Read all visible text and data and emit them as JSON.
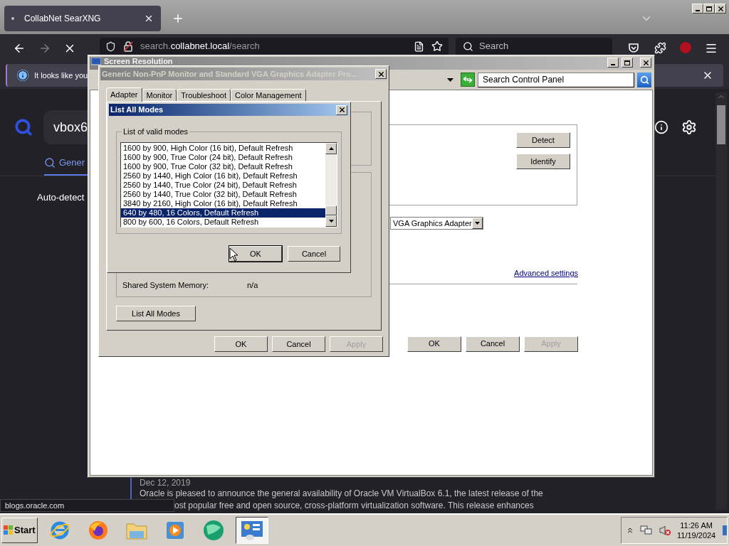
{
  "browser": {
    "tab_title": "CollabNet SearXNG",
    "url_prefix": "search.",
    "url_domain": "collabnet.local",
    "url_path": "/search",
    "search_placeholder": "Search",
    "notification": "It looks like you",
    "query": "vbox6",
    "category_tab": {
      "label": "Gener",
      "selected": true
    },
    "auto_detect": "Auto-detect",
    "result": {
      "date": "Dec 12, 2019",
      "line_1": "Oracle is pleased to announce the general availability of Oracle VM VirtualBox 6.1, the latest release of the",
      "line_2": "ost popular free and open source, cross-platform virtualization software. This release enhances"
    },
    "status_url": "blogs.oracle.com"
  },
  "control_panel": {
    "title": "Screen Resolution",
    "search_placeholder": "Search Control Panel",
    "side_buttons": [
      "Detect",
      "Identify"
    ],
    "display_dropdown": "VGA Graphics Adapter",
    "advanced_link": "Advanced settings",
    "footer_buttons": [
      {
        "label": "OK",
        "disabled": false
      },
      {
        "label": "Cancel",
        "disabled": false
      },
      {
        "label": "Apply",
        "disabled": true
      }
    ]
  },
  "adapter_dialog": {
    "title": "Generic Non-PnP Monitor and Standard VGA Graphics Adapter Pro...",
    "tabs": [
      {
        "label": "Adapter",
        "selected": true
      },
      {
        "label": "Monitor",
        "selected": false
      },
      {
        "label": "Troubleshoot",
        "selected": false
      },
      {
        "label": "Color Management",
        "selected": false
      }
    ],
    "info": [
      {
        "label": "Shared System Memory:",
        "value": "n/a"
      }
    ],
    "list_button": "List All Modes",
    "footer_buttons": [
      {
        "label": "OK",
        "disabled": false
      },
      {
        "label": "Cancel",
        "disabled": false
      },
      {
        "label": "Apply",
        "disabled": true
      }
    ]
  },
  "modes_dialog": {
    "title": "List All Modes",
    "group_label": "List of valid modes",
    "modes": [
      {
        "label": "1600 by 900, High Color (16 bit), Default Refresh",
        "selected": false
      },
      {
        "label": "1600 by 900, True Color (24 bit), Default Refresh",
        "selected": false
      },
      {
        "label": "1600 by 900, True Color (32 bit), Default Refresh",
        "selected": false
      },
      {
        "label": "2560 by 1440, High Color (16 bit), Default Refresh",
        "selected": false
      },
      {
        "label": "2560 by 1440, True Color (24 bit), Default Refresh",
        "selected": false
      },
      {
        "label": "2560 by 1440, True Color (32 bit), Default Refresh",
        "selected": false
      },
      {
        "label": "3840 by 2160, High Color (16 bit), Default Refresh",
        "selected": false
      },
      {
        "label": "640 by 480, 16 Colors, Default Refresh",
        "selected": true
      },
      {
        "label": "800 by 600, 16 Colors, Default Refresh",
        "selected": false
      }
    ],
    "buttons": [
      {
        "label": "OK",
        "default": true
      },
      {
        "label": "Cancel",
        "default": false
      }
    ]
  },
  "taskbar": {
    "start": "Start",
    "apps": [
      {
        "kind": "ie",
        "active": false
      },
      {
        "kind": "fox",
        "active": false
      },
      {
        "kind": "folder",
        "active": false
      },
      {
        "kind": "media",
        "active": false
      },
      {
        "kind": "globe",
        "active": false
      },
      {
        "kind": "panel",
        "active": true
      }
    ],
    "time": "11:26 AM",
    "date": "11/19/2024"
  }
}
